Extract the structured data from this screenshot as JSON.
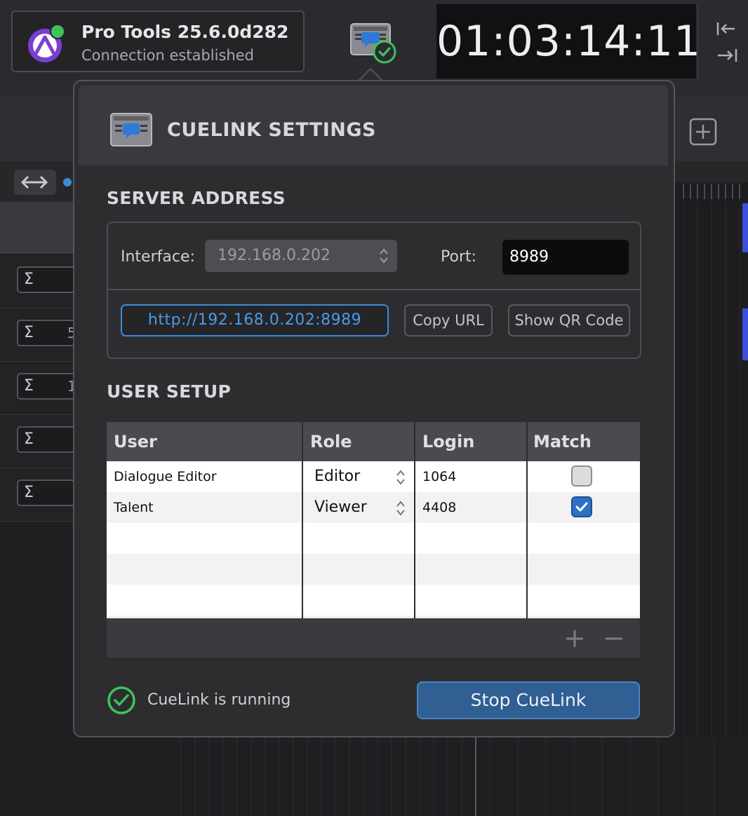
{
  "app": {
    "title": "Pro Tools 25.6.0d282",
    "status": "Connection established",
    "logo_icon": "pro-tools-logo",
    "status_color": "#3ec35b"
  },
  "timecode": "01:03:14:11",
  "background": {
    "track_rows": [
      {
        "sigma": "Σ",
        "num": ""
      },
      {
        "sigma": "Σ",
        "num": "5"
      },
      {
        "sigma": "Σ",
        "num": "1"
      },
      {
        "sigma": "Σ",
        "num": ""
      },
      {
        "sigma": "Σ",
        "num": ""
      }
    ]
  },
  "popover": {
    "title": "CUELINK SETTINGS",
    "server": {
      "section_title": "SERVER ADDRESS",
      "interface_label": "Interface:",
      "interface_value": "192.168.0.202",
      "port_label": "Port:",
      "port_value": "8989",
      "url": "http://192.168.0.202:8989",
      "copy_url_label": "Copy URL",
      "show_qr_label": "Show QR Code"
    },
    "users": {
      "section_title": "USER SETUP",
      "columns": [
        "User",
        "Role",
        "Login",
        "Match Filters"
      ],
      "rows": [
        {
          "user": "Dialogue Editor",
          "role": "Editor",
          "login": "1064",
          "match_filters": false
        },
        {
          "user": "Talent",
          "role": "Viewer",
          "login": "4408",
          "match_filters": true
        }
      ],
      "add_label": "+",
      "remove_label": "−"
    },
    "status_text": "CueLink is running",
    "stop_label": "Stop CueLink",
    "accent": "#3d8ad9",
    "ok_color": "#3ec35b"
  }
}
